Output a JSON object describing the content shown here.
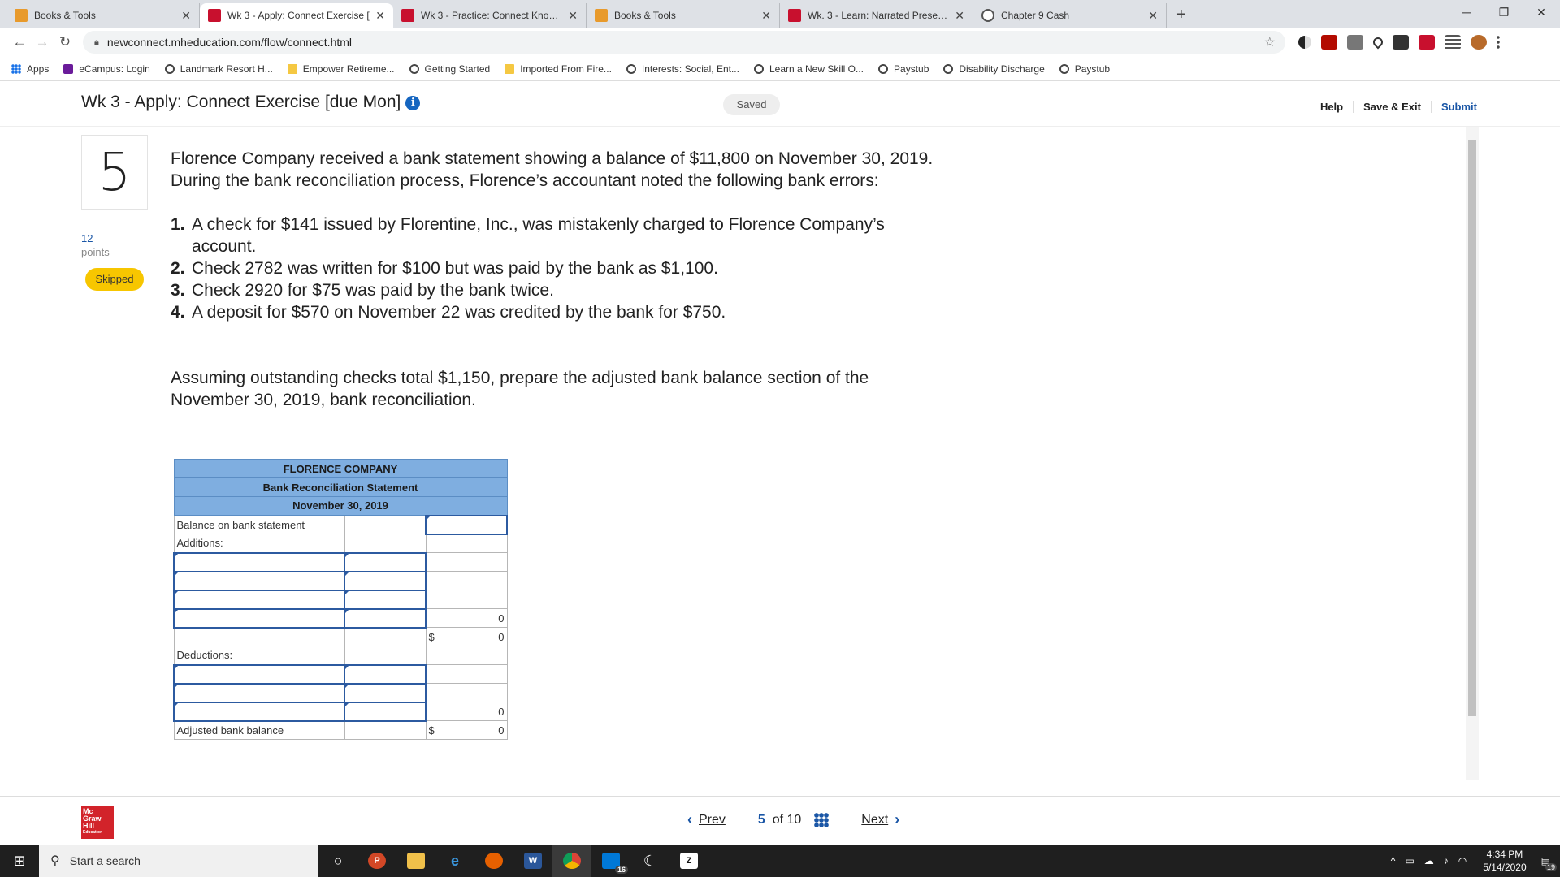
{
  "browser": {
    "tabs": [
      {
        "title": "Books & Tools",
        "icon": "orange"
      },
      {
        "title": "Wk 3 - Apply: Connect Exercise [",
        "icon": "red"
      },
      {
        "title": "Wk 3 - Practice: Connect Knowle",
        "icon": "red"
      },
      {
        "title": "Books & Tools",
        "icon": "orange"
      },
      {
        "title": "Wk. 3 - Learn: Narrated Presenta",
        "icon": "red"
      },
      {
        "title": "Chapter 9 Cash",
        "icon": "globe"
      }
    ],
    "url": "newconnect.mheducation.com/flow/connect.html",
    "bookmarks": [
      {
        "label": "Apps",
        "icon": "grid"
      },
      {
        "label": "eCampus: Login",
        "icon": "yel"
      },
      {
        "label": "Landmark Resort H...",
        "icon": "globe"
      },
      {
        "label": "Empower Retireme...",
        "icon": "folder"
      },
      {
        "label": "Getting Started",
        "icon": "globe"
      },
      {
        "label": "Imported From Fire...",
        "icon": "folder"
      },
      {
        "label": "Interests: Social, Ent...",
        "icon": "globe"
      },
      {
        "label": "Learn a New Skill O...",
        "icon": "globe"
      },
      {
        "label": "Paystub",
        "icon": "globe"
      },
      {
        "label": "Disability Discharge",
        "icon": "globe"
      },
      {
        "label": "Paystub",
        "icon": "globe"
      }
    ]
  },
  "header": {
    "title": "Wk 3 - Apply: Connect Exercise [due Mon]",
    "status": "Saved",
    "help": "Help",
    "save_exit": "Save & Exit",
    "submit": "Submit"
  },
  "question": {
    "number": "5",
    "points_value": "12",
    "points_label": "points",
    "badge": "Skipped",
    "intro": "Florence Company received a bank statement showing a balance of $11,800 on November 30, 2019. During the bank reconciliation process, Florence’s accountant noted the following bank errors:",
    "errors": [
      {
        "n": "1.",
        "text": "A check for $141 issued by Florentine, Inc., was mistakenly charged to Florence Company’s account."
      },
      {
        "n": "2.",
        "text": "Check 2782 was written for $100 but was paid by the bank as $1,100."
      },
      {
        "n": "3.",
        "text": "Check 2920 for $75 was paid by the bank twice."
      },
      {
        "n": "4.",
        "text": "A deposit for $570 on November 22 was credited by the bank for $750."
      }
    ],
    "instruction": "Assuming outstanding checks total $1,150, prepare the adjusted bank balance section of the November 30, 2019, bank reconciliation."
  },
  "reconciliation": {
    "company": "FLORENCE COMPANY",
    "statement": "Bank Reconciliation Statement",
    "date": "November 30, 2019",
    "balance_label": "Balance on bank statement",
    "additions_label": "Additions:",
    "additions_subtotal": "0",
    "additions_total_symbol": "$",
    "additions_total": "0",
    "deductions_label": "Deductions:",
    "deductions_subtotal": "0",
    "adjusted_label": "Adjusted bank balance",
    "adjusted_symbol": "$",
    "adjusted_value": "0"
  },
  "footer": {
    "logo_lines": [
      "Mc",
      "Graw",
      "Hill",
      "Education"
    ],
    "prev": "Prev",
    "current": "5",
    "of_text": "of 10",
    "next": "Next"
  },
  "taskbar": {
    "search_placeholder": "Start a search",
    "mail_badge": "16",
    "time": "4:34 PM",
    "date": "5/14/2020",
    "notif_count": "19"
  }
}
